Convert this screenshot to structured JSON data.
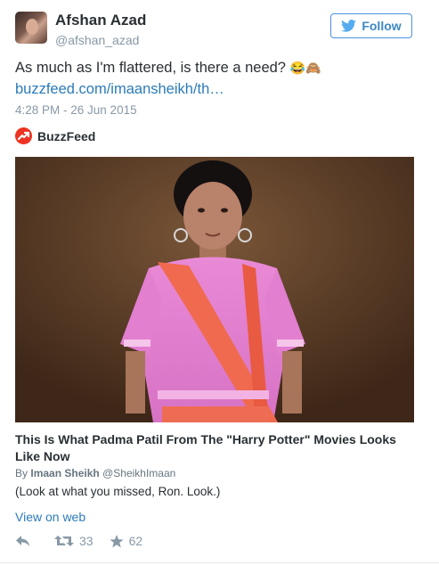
{
  "author": {
    "name": "Afshan Azad",
    "handle": "@afshan_azad"
  },
  "follow_button": {
    "label": "Follow",
    "color": "#3b88c3"
  },
  "tweet": {
    "text": "As much as I'm flattered, is there a need?",
    "emojis": "😂🙈",
    "link": "buzzfeed.com/imaansheikh/th…",
    "timestamp": "4:28 PM - 26 Jun 2015"
  },
  "source": {
    "name": "BuzzFeed",
    "brand_color": "#ee3322"
  },
  "card": {
    "title": "This Is What Padma Patil From The \"Harry Potter\" Movies Looks Like Now",
    "byline_prefix": "By",
    "author": "Imaan Sheikh",
    "author_handle": "@SheikhImaan",
    "description": "(Look at what you missed, Ron. Look.)",
    "view_link": "View on web"
  },
  "actions": {
    "retweets": "33",
    "likes": "62"
  }
}
